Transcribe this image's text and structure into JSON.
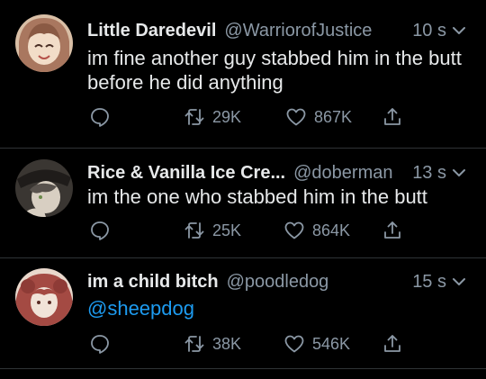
{
  "tweets": [
    {
      "name": "Little Daredevil",
      "handle": "@WarriorofJustice",
      "time": "10 s",
      "text": "im fine another guy stabbed him in the butt before he did anything",
      "retweets": "29K",
      "likes": "867K",
      "avatar_color": "#a9775f"
    },
    {
      "name": "Rice & Vanilla Ice Cre...",
      "handle": "@doberman",
      "time": "13 s",
      "text": "im the one who stabbed him in the butt",
      "retweets": "25K",
      "likes": "864K",
      "avatar_color": "#58524d"
    },
    {
      "name": "im a child bitch",
      "handle": "@poodledog",
      "time": "15 s",
      "text": "@sheepdog",
      "retweets": "38K",
      "likes": "546K",
      "avatar_color": "#a44a43"
    }
  ],
  "colors": {
    "background": "#000000",
    "text": "#e7e9ea",
    "secondary": "#8b98a5",
    "link": "#1d9bf0",
    "divider": "#2f3336"
  }
}
